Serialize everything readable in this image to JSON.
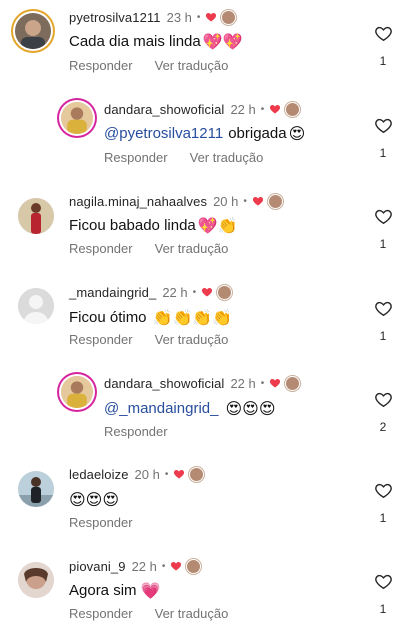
{
  "colors": {
    "like_heart": "#ed3a4c",
    "mention": "#284e9e",
    "muted": "#737373",
    "story_ring_orange": "#e4a52b",
    "story_ring_pink": "#d6249f"
  },
  "comments": [
    {
      "user": "pyetrosilva1211",
      "time": "23 h",
      "separator": "•",
      "text": "Cada dia mais linda",
      "emojis": "💖💖",
      "reply_label": "Responder",
      "translate_label": "Ver tradução",
      "likes": "1"
    },
    {
      "user": "dandara_showoficial",
      "time": "22 h",
      "separator": "•",
      "mention": "@pyetrosilva1211",
      "text": "obrigada",
      "emojis": "😍",
      "reply_label": "Responder",
      "translate_label": "Ver tradução",
      "likes": "1"
    },
    {
      "user": "nagila.minaj_nahaalves",
      "time": "20 h",
      "separator": "•",
      "text": "Ficou babado linda",
      "emojis": "💖👏",
      "reply_label": "Responder",
      "translate_label": "Ver tradução",
      "likes": "1"
    },
    {
      "user": "_mandaingrid_",
      "time": "22 h",
      "separator": "•",
      "text": "Ficou ótimo",
      "emojis": "👏👏👏👏",
      "reply_label": "Responder",
      "translate_label": "Ver tradução",
      "likes": "1"
    },
    {
      "user": "dandara_showoficial",
      "time": "22 h",
      "separator": "•",
      "mention": "@_mandaingrid_",
      "text": "",
      "emojis": "😍😍😍",
      "reply_label": "Responder",
      "likes": "2"
    },
    {
      "user": "ledaeloize",
      "time": "20 h",
      "separator": "•",
      "text": "",
      "emojis": "😍😍😍",
      "reply_label": "Responder",
      "likes": "1"
    },
    {
      "user": "piovani_9",
      "time": "22 h",
      "separator": "•",
      "text": "Agora sim",
      "emojis": "💗",
      "reply_label": "Responder",
      "translate_label": "Ver tradução",
      "likes": "1"
    }
  ]
}
